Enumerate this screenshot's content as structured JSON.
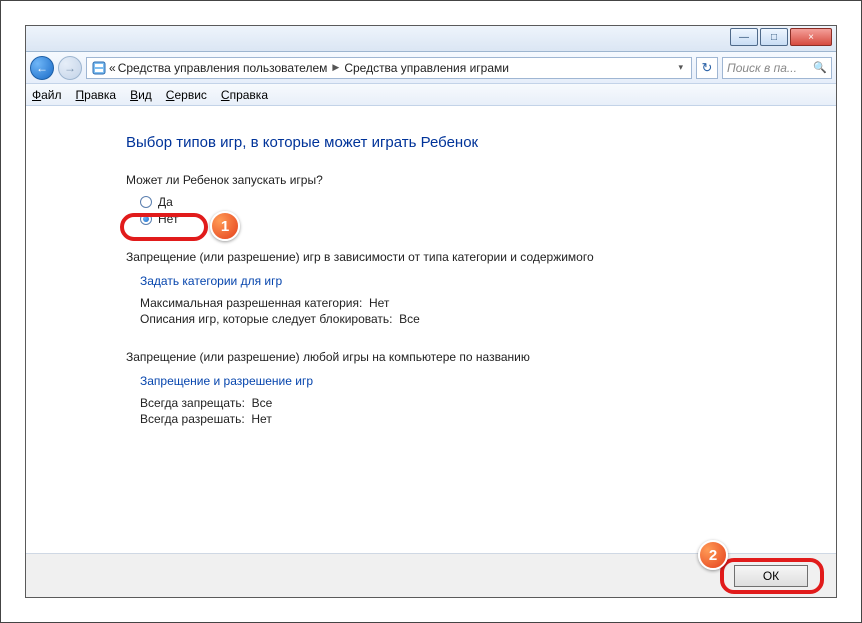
{
  "titlebar": {
    "minimize": "—",
    "maximize": "□",
    "close": "×"
  },
  "nav": {
    "back": "←",
    "forward": "→",
    "crumb_prefix": "«",
    "crumb1": "Средства управления пользователем",
    "crumb2": "Средства управления играми",
    "refresh": "↻",
    "search_placeholder": "Поиск в па..."
  },
  "menu": {
    "file": "Файл",
    "edit": "Правка",
    "view": "Вид",
    "service": "Сервис",
    "help": "Справка"
  },
  "main": {
    "heading": "Выбор типов игр, в которые может играть Ребенок",
    "question": "Может ли Ребенок запускать игры?",
    "radio_yes": "Да",
    "radio_no": "Нет",
    "section2_title": "Запрещение (или разрешение) игр в зависимости от типа категории и содержимого",
    "link_categories": "Задать категории для игр",
    "max_category_label": "Максимальная разрешенная категория:",
    "max_category_value": "Нет",
    "desc_block_label": "Описания игр, которые следует блокировать:",
    "desc_block_value": "Все",
    "section3_title": "Запрещение (или разрешение) любой игры на компьютере по названию",
    "link_blockallow": "Запрещение и разрешение игр",
    "always_deny_label": "Всегда запрещать:",
    "always_deny_value": "Все",
    "always_allow_label": "Всегда разрешать:",
    "always_allow_value": "Нет"
  },
  "annotations": {
    "marker1": "1",
    "marker2": "2"
  },
  "footer": {
    "ok": "ОК"
  }
}
